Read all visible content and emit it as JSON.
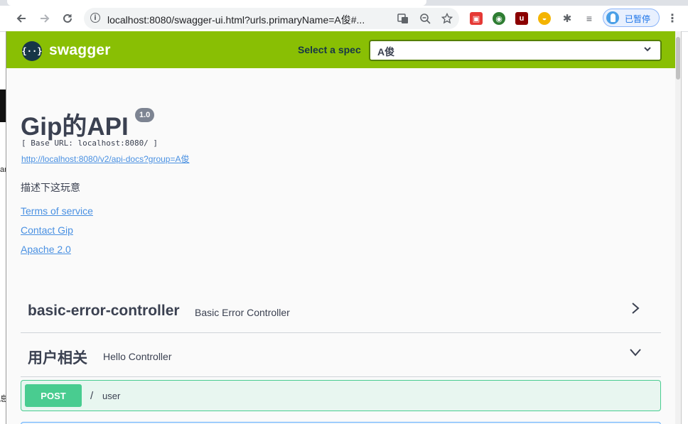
{
  "browser": {
    "url": "localhost:8080/swagger-ui.html?urls.primaryName=A俊#...",
    "profile_status": "已暂停",
    "icons": [
      "back-icon",
      "forward-icon",
      "reload-icon",
      "info-icon",
      "translate-icon",
      "zoom-icon",
      "star-icon",
      "extensions-icon",
      "reading-list-icon",
      "menu-icon"
    ]
  },
  "background": {
    "sliver_text_1": "ar",
    "sliver_text_2": "息"
  },
  "swagger": {
    "logo_glyph": "{··}",
    "brand": "swagger",
    "spec_label": "Select a spec",
    "spec_value": "A俊",
    "topbar_color": "#89bf04"
  },
  "info": {
    "title": "Gip的API",
    "version": "1.0",
    "base_url": "[ Base URL: localhost:8080/ ]",
    "docs_url": "http://localhost:8080/v2/api-docs?group=A俊",
    "description": "描述下这玩意",
    "terms": "Terms of service",
    "contact": "Contact Gip",
    "license": "Apache 2.0"
  },
  "tags": [
    {
      "name": "basic-error-controller",
      "description": "Basic Error Controller",
      "expanded": false
    },
    {
      "name": "用户相关",
      "description": "Hello Controller",
      "expanded": true
    }
  ],
  "operations": [
    {
      "method": "POST",
      "slash": "/",
      "path": "user",
      "color": "#49cc90"
    }
  ]
}
